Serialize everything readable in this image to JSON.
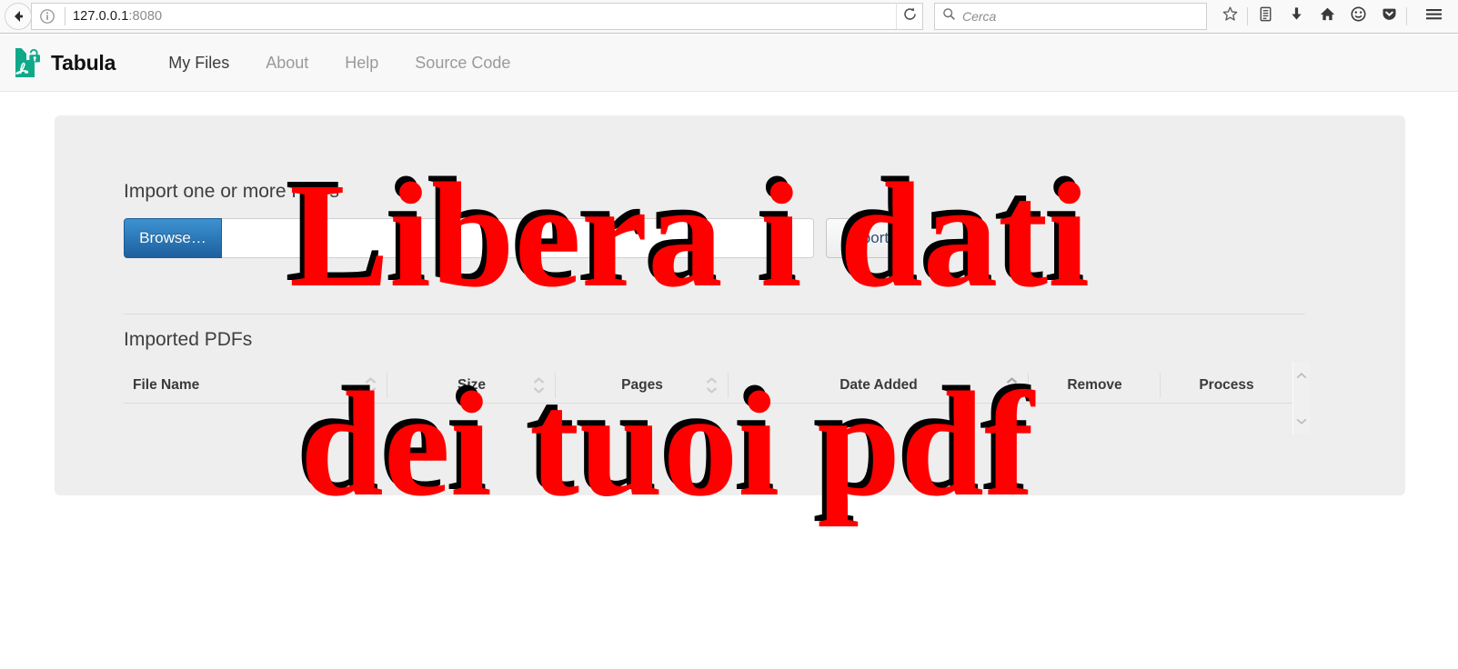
{
  "browser": {
    "back_icon": "back-arrow-icon",
    "identity_icon": "info-circle-icon",
    "url_host": "127.0.0.1",
    "url_port": ":8080",
    "reload_icon": "reload-icon",
    "search_icon": "search-icon",
    "search_placeholder": "Cerca",
    "toolbar_icons": [
      {
        "name": "bookmark-star-icon"
      },
      {
        "name": "reader-list-icon"
      },
      {
        "name": "downloads-icon"
      },
      {
        "name": "home-icon"
      },
      {
        "name": "smiley-feedback-icon"
      },
      {
        "name": "pocket-icon"
      },
      {
        "name": "hamburger-menu-icon"
      }
    ]
  },
  "site": {
    "brand_name": "Tabula",
    "brand_logo_icon": "tabula-pdf-unlock-icon",
    "brand_color": "#0fa98a",
    "nav_links": [
      {
        "label": "My Files",
        "active": true
      },
      {
        "label": "About",
        "active": false
      },
      {
        "label": "Help",
        "active": false
      },
      {
        "label": "Source Code",
        "active": false
      }
    ]
  },
  "import_section": {
    "title": "Import one or more PDFs",
    "browse_button": "Browse…",
    "file_input_value": "",
    "file_input_placeholder": "",
    "import_button": "Import"
  },
  "table_section": {
    "title": "Imported PDFs",
    "columns": [
      {
        "label": "File Name",
        "sortable": true
      },
      {
        "label": "Size",
        "sortable": true
      },
      {
        "label": "Pages",
        "sortable": true
      },
      {
        "label": "Date Added",
        "sortable": true
      },
      {
        "label": "Remove",
        "sortable": false
      },
      {
        "label": "Process",
        "sortable": false
      }
    ],
    "rows": []
  },
  "scrollbar": {
    "up_icon": "chevron-up-icon",
    "down_icon": "chevron-down-icon"
  },
  "overlay_text": {
    "line1": "Libera i dati",
    "line2": "dei tuoi pdf",
    "color": "#ff0000",
    "shadow_color": "#000000"
  }
}
